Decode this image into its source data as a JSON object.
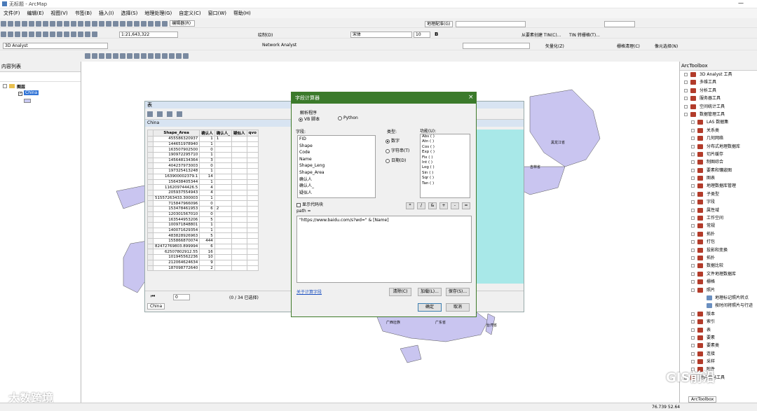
{
  "window": {
    "title": "无标题 - ArcMap"
  },
  "menu": [
    "文件(F)",
    "编辑(E)",
    "视图(V)",
    "书签(B)",
    "插入(I)",
    "选择(S)",
    "地理处理(G)",
    "自定义(C)",
    "窗口(W)",
    "帮助(H)"
  ],
  "toolbar": {
    "scale": "1:21,643,322",
    "editor": "编辑器(R)",
    "georef": "地理配准(G)",
    "draw": "绘制(D)",
    "font": "宋体",
    "fontsize": "10",
    "analyst3d": "3D Analyst",
    "network": "Network Analyst",
    "tin": "从要素创建 TIN(C)...",
    "tin2": "TIN 转栅格(T)...",
    "vectorize": "矢量化(Z)",
    "raster_clean": "栅格清理(C)",
    "cell_select": "像元选择(N)"
  },
  "toc": {
    "title": "内容列表",
    "layers_group": "图层",
    "layer": "China"
  },
  "table": {
    "title": "表",
    "tab": "China",
    "columns": [
      "Shape_Area",
      "确认人",
      "确认人_",
      "疑似人",
      "qvo"
    ],
    "record_nav": "0",
    "selected": "(0 / 34 已选择)",
    "rows": [
      [
        "455586320937",
        "1",
        "1",
        ""
      ],
      [
        "144651978940",
        "1",
        "",
        ""
      ],
      [
        "163507902500",
        "0",
        "",
        ""
      ],
      [
        "190972295710",
        "1",
        "",
        ""
      ],
      [
        "145648134364",
        "3",
        "",
        ""
      ],
      [
        "404237973003",
        "0",
        "",
        ""
      ],
      [
        "197325413248",
        "1",
        "",
        ""
      ],
      [
        "163900002379.1",
        "14",
        "",
        ""
      ],
      [
        "156438405344",
        "1",
        "",
        ""
      ],
      [
        "116209744426.5",
        "4",
        "",
        ""
      ],
      [
        "205937554943",
        "4",
        "",
        ""
      ],
      [
        "51557263433.300003",
        "1",
        "",
        ""
      ],
      [
        "715847966096",
        "0",
        "",
        ""
      ],
      [
        "153478461953",
        "6",
        "2",
        ""
      ],
      [
        "120301567010",
        "0",
        "",
        ""
      ],
      [
        "163544953206",
        "5",
        "",
        ""
      ],
      [
        "100971848801",
        "1",
        "",
        ""
      ],
      [
        "140071629354",
        "1",
        "",
        ""
      ],
      [
        "483828926963",
        "5",
        "",
        ""
      ],
      [
        "155866870074",
        "444",
        "",
        ""
      ],
      [
        "82472769803.899994",
        "6",
        "",
        ""
      ],
      [
        "62507802912.55",
        "16",
        "",
        ""
      ],
      [
        "101945562236",
        "10",
        "",
        ""
      ],
      [
        "212064624634",
        "9",
        "",
        ""
      ],
      [
        "187098772640",
        "2",
        "",
        ""
      ]
    ]
  },
  "dialog": {
    "title": "字段计算器",
    "parser_label": "解析程序",
    "vb": "VB 脚本",
    "python": "Python",
    "fields_label": "字段:",
    "fields": [
      "FID",
      "Shape",
      "Code",
      "Name",
      "Shape_Leng",
      "Shape_Area",
      "确认人",
      "确认人_",
      "疑似人"
    ],
    "type_label": "类型:",
    "types": [
      "数字",
      "字符串(T)",
      "日期(D)"
    ],
    "functions_label": "功能(U):",
    "functions": [
      "Abs ( )",
      "Atn ( )",
      "Cos ( )",
      "Exp ( )",
      "Fix ( )",
      "Int ( )",
      "Log ( )",
      "Sin ( )",
      "Sqr ( )",
      "Tan ( )"
    ],
    "show_code": "显示代码块",
    "expr_label": "path =",
    "expression": "\"https://www.baidu.com/s?wd=\" & [Name]",
    "ops": [
      "*",
      "/",
      "&",
      "+",
      "-",
      "="
    ],
    "help_link": "关于计算字段",
    "clear": "清除(C)",
    "load": "加载(L)...",
    "save": "保存(S)...",
    "ok": "确定",
    "cancel": "取消"
  },
  "toolbox": {
    "title": "ArcToolbox",
    "tab": "ArcToolbox",
    "items": [
      {
        "l": "3D Analyst 工具",
        "lv": 0
      },
      {
        "l": "多维工具",
        "lv": 0
      },
      {
        "l": "分析工具",
        "lv": 0
      },
      {
        "l": "服务器工具",
        "lv": 0
      },
      {
        "l": "空间统计工具",
        "lv": 0
      },
      {
        "l": "数据管理工具",
        "lv": 0
      },
      {
        "l": "LAS 数据集",
        "lv": 1
      },
      {
        "l": "关系类",
        "lv": 1
      },
      {
        "l": "几何网络",
        "lv": 1
      },
      {
        "l": "分布式地理数据库",
        "lv": 1
      },
      {
        "l": "切片缓存",
        "lv": 1
      },
      {
        "l": "制图综合",
        "lv": 1
      },
      {
        "l": "要素和镶嵌图",
        "lv": 1
      },
      {
        "l": "图表",
        "lv": 1
      },
      {
        "l": "地理数据库管理",
        "lv": 1
      },
      {
        "l": "子类型",
        "lv": 1
      },
      {
        "l": "字段",
        "lv": 1
      },
      {
        "l": "属性域",
        "lv": 1
      },
      {
        "l": "工作空间",
        "lv": 1
      },
      {
        "l": "常规",
        "lv": 1
      },
      {
        "l": "拓扑",
        "lv": 1
      },
      {
        "l": "打包",
        "lv": 1
      },
      {
        "l": "投影和变换",
        "lv": 1
      },
      {
        "l": "拓扑",
        "lv": 1
      },
      {
        "l": "数据比较",
        "lv": 1
      },
      {
        "l": "文件地理数据库",
        "lv": 1
      },
      {
        "l": "栅格",
        "lv": 1
      },
      {
        "l": "照片",
        "lv": 1
      },
      {
        "l": "地理标记照片转点",
        "lv": 2
      },
      {
        "l": "按时间将照片与行迹",
        "lv": 2
      },
      {
        "l": "版本",
        "lv": 1
      },
      {
        "l": "索引",
        "lv": 1
      },
      {
        "l": "表",
        "lv": 1
      },
      {
        "l": "要素",
        "lv": 1
      },
      {
        "l": "要素类",
        "lv": 1
      },
      {
        "l": "连接",
        "lv": 1
      },
      {
        "l": "采样",
        "lv": 1
      },
      {
        "l": "附件",
        "lv": 1
      },
      {
        "l": "地理编码工具",
        "lv": 0
      }
    ]
  },
  "map_labels": [
    "黑龙江省",
    "吉林省",
    "广西壮族",
    "广东省",
    "台湾省"
  ],
  "status": {
    "coords": "76.739  52.64",
    "watermark1": "大数跨境",
    "watermark2": "GIS前沿"
  }
}
